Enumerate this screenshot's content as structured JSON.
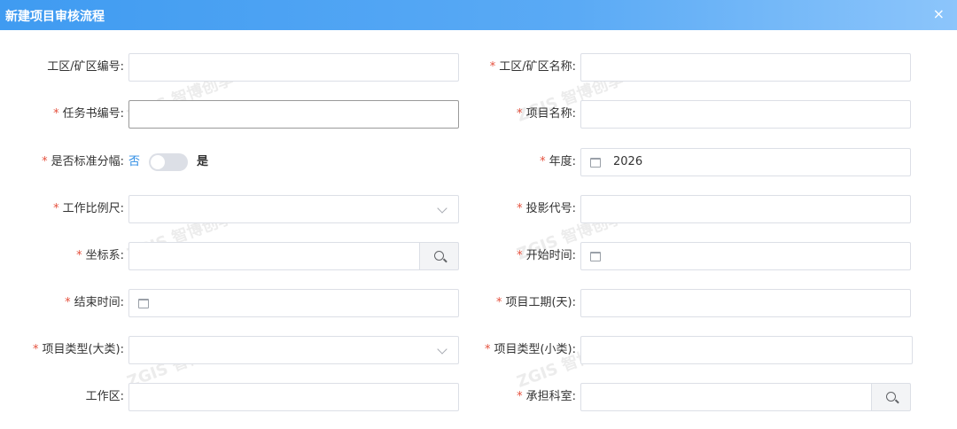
{
  "dialog": {
    "title": "新建项目审核流程",
    "close_glyph": "×"
  },
  "watermark": "ZGIS 智博创享",
  "form": {
    "required_mark": "*",
    "work_area_no_label": "工区/矿区编号:",
    "work_area_name_label": "工区/矿区名称:",
    "task_book_no_label": "任务书编号:",
    "project_name_label": "项目名称:",
    "standard_sheet_label": "是否标准分幅:",
    "standard_sheet_off": "否",
    "standard_sheet_on": "是",
    "standard_sheet_value": "off",
    "year_label": "年度:",
    "year_value": "2026",
    "scale_label": "工作比例尺:",
    "projection_code_label": "投影代号:",
    "coord_system_label": "坐标系:",
    "start_time_label": "开始时间:",
    "end_time_label": "结束时间:",
    "duration_label": "项目工期(天):",
    "type_major_label": "项目类型(大类):",
    "type_minor_label": "项目类型(小类):",
    "work_zone_label": "工作区:",
    "department_label": "承担科室:"
  },
  "icons": {
    "calendar": "calendar-icon",
    "chevron": "chevron-down-icon",
    "search": "search-icon",
    "close": "close-icon"
  },
  "colors": {
    "title_bar_start": "#3f9bf1",
    "title_bar_end": "#8cc5fb",
    "required": "#e5503d",
    "switch_off_text": "#2f8de4"
  }
}
